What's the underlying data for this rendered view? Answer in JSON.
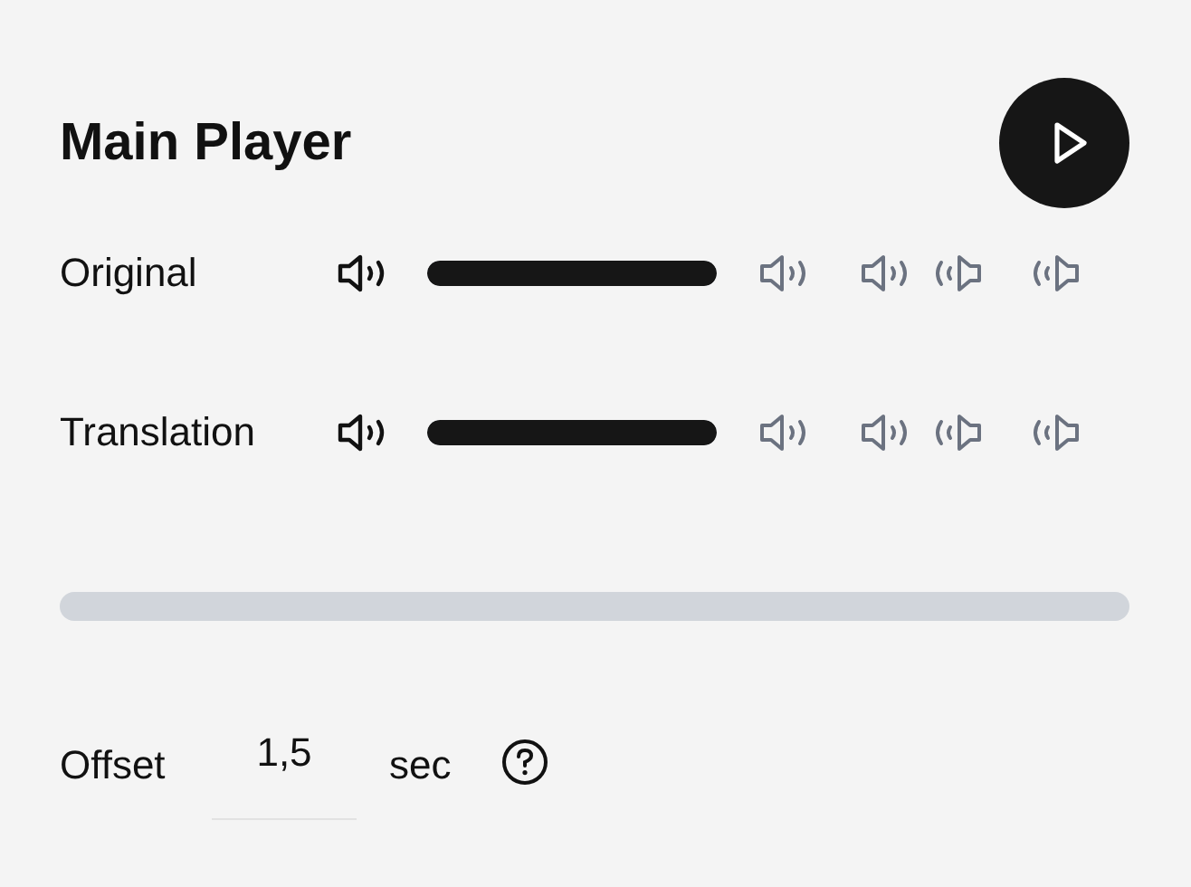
{
  "title": "Main Player",
  "channels": [
    {
      "name": "Original",
      "level": 1
    },
    {
      "name": "Translation",
      "level": 1
    }
  ],
  "offset": {
    "label": "Offset",
    "value": "1,5",
    "unit": "sec"
  }
}
